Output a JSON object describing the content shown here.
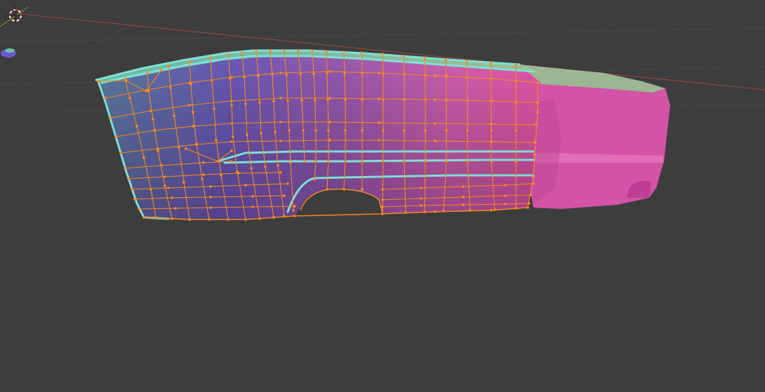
{
  "viewport": {
    "background_color": "#3d3d3d",
    "grid_color": "#4a4a4a",
    "x_axis_color": "#b04848",
    "y_axis_color": "#7aa034"
  },
  "mesh": {
    "edge_color": "#f08a1c",
    "vertex_color": "#ff8a1a",
    "seam_color": "#7ee0d6",
    "shading_colors": [
      "#5a6aa0",
      "#7050b0",
      "#b050a8",
      "#e050b0",
      "#88cc88"
    ]
  },
  "icons": [
    "3d-cursor-icon",
    "object-origin-icon"
  ]
}
